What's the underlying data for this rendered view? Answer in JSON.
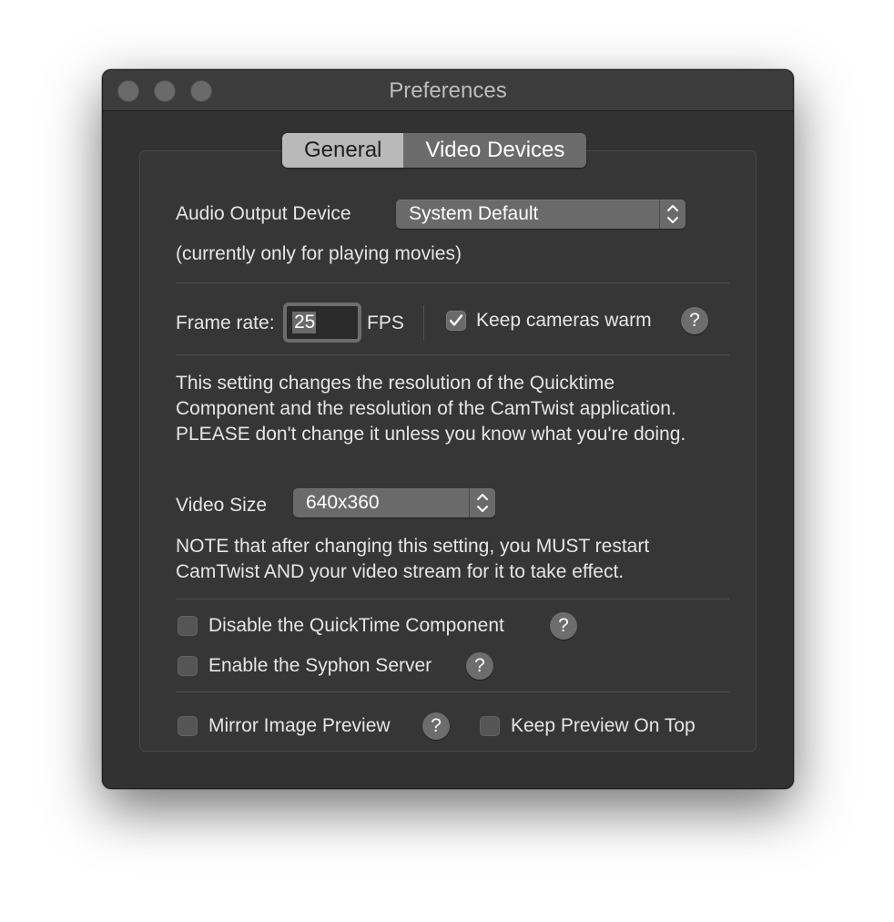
{
  "window": {
    "title": "Preferences"
  },
  "tabs": [
    {
      "label": "General",
      "active": false
    },
    {
      "label": "Video Devices",
      "active": true
    }
  ],
  "audio": {
    "label": "Audio Output Device",
    "selected": "System Default",
    "note": "(currently only for playing movies)"
  },
  "frame_rate": {
    "label": "Frame rate:",
    "value": "25",
    "unit": "FPS",
    "keep_warm_label": "Keep cameras warm",
    "keep_warm_checked": true
  },
  "resolution": {
    "warning": "This setting changes the resolution of the Quicktime Component and the resolution of the CamTwist application.  PLEASE don't change it unless you know what you're doing.",
    "video_size_label": "Video Size",
    "video_size_selected": "640x360",
    "note": "NOTE that after changing this setting, you MUST restart CamTwist AND your video stream for it to take effect."
  },
  "options": {
    "disable_qt_label": "Disable the QuickTime Component",
    "disable_qt_checked": false,
    "syphon_label": "Enable the Syphon Server",
    "syphon_checked": false,
    "mirror_label": "Mirror Image Preview",
    "mirror_checked": false,
    "ontop_label": "Keep Preview On Top",
    "ontop_checked": false
  },
  "help_glyph": "?",
  "colors": {
    "window_bg": "#323232",
    "titlebar_bg": "#3c3c3c",
    "control_bg": "#6a6a6a",
    "text": "#e6e6e6"
  }
}
